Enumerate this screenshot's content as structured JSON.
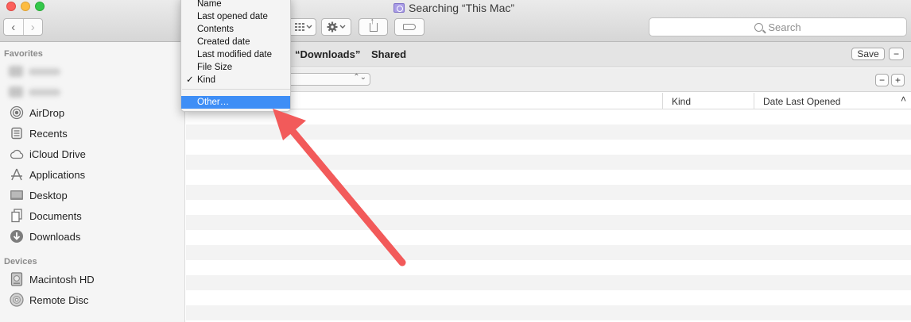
{
  "window": {
    "title": "Searching “This Mac”"
  },
  "toolbar": {
    "back_glyph": "‹",
    "forward_glyph": "›",
    "search_placeholder": "Search"
  },
  "sidebar": {
    "favorites_header": "Favorites",
    "devices_header": "Devices",
    "favorites": [
      {
        "label": "AirDrop",
        "icon": "airdrop-icon"
      },
      {
        "label": "Recents",
        "icon": "recents-icon"
      },
      {
        "label": "iCloud Drive",
        "icon": "cloud-icon"
      },
      {
        "label": "Applications",
        "icon": "applications-icon"
      },
      {
        "label": "Desktop",
        "icon": "desktop-icon"
      },
      {
        "label": "Documents",
        "icon": "documents-icon"
      },
      {
        "label": "Downloads",
        "icon": "downloads-icon"
      }
    ],
    "devices": [
      {
        "label": "Macintosh HD",
        "icon": "hard-drive-icon"
      },
      {
        "label": "Remote Disc",
        "icon": "disc-icon"
      }
    ]
  },
  "search_scope": {
    "downloads": "“Downloads”",
    "shared": "Shared",
    "save_label": "Save",
    "minus_label": "−",
    "plus_label": "+"
  },
  "columns": {
    "kind": "Kind",
    "date_last_opened": "Date Last Opened",
    "sort_glyph": "˄"
  },
  "attribute_menu": {
    "items": [
      {
        "label": "Name",
        "checked": false
      },
      {
        "label": "Last opened date",
        "checked": false
      },
      {
        "label": "Contents",
        "checked": false
      },
      {
        "label": "Created date",
        "checked": false
      },
      {
        "label": "Last modified date",
        "checked": false
      },
      {
        "label": "File Size",
        "checked": false
      },
      {
        "label": "Kind",
        "checked": true
      }
    ],
    "other_label": "Other…",
    "check_glyph": "✓"
  },
  "colors": {
    "highlight": "#3e8ef6",
    "annotation_arrow": "#f25a5a"
  }
}
